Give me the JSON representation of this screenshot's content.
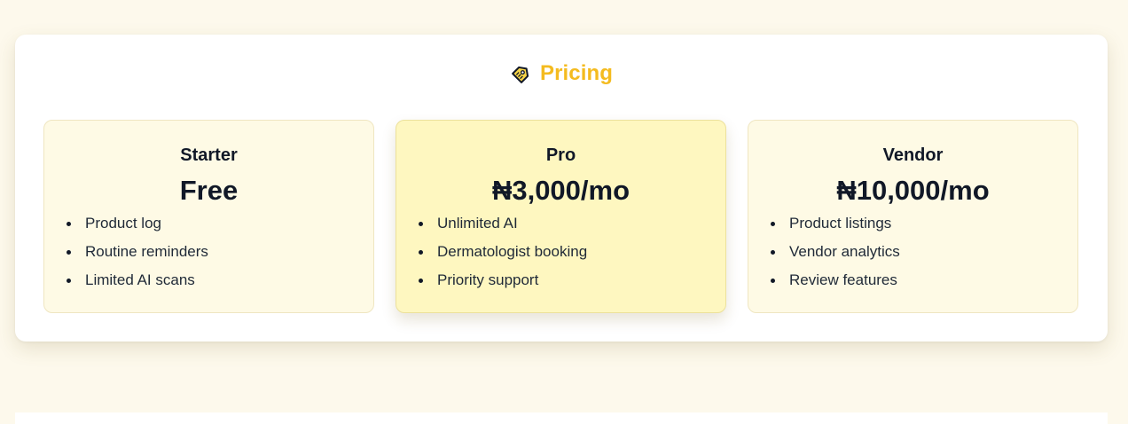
{
  "pricing": {
    "icon": "tag-icon",
    "title": "Pricing",
    "accent_color": "#f4bb1f",
    "plans": [
      {
        "name": "Starter",
        "price": "Free",
        "featured": false,
        "features": [
          "Product log",
          "Routine reminders",
          "Limited AI scans"
        ]
      },
      {
        "name": "Pro",
        "price": "₦3,000/mo",
        "featured": true,
        "features": [
          "Unlimited AI",
          "Dermatologist booking",
          "Priority support"
        ]
      },
      {
        "name": "Vendor",
        "price": "₦10,000/mo",
        "featured": false,
        "features": [
          "Product listings",
          "Vendor analytics",
          "Review features"
        ]
      }
    ]
  },
  "colors": {
    "page_background": "#fdf9ec",
    "card_background": "#fefae5",
    "featured_card_background": "#fef7c0",
    "text": "#111827"
  }
}
